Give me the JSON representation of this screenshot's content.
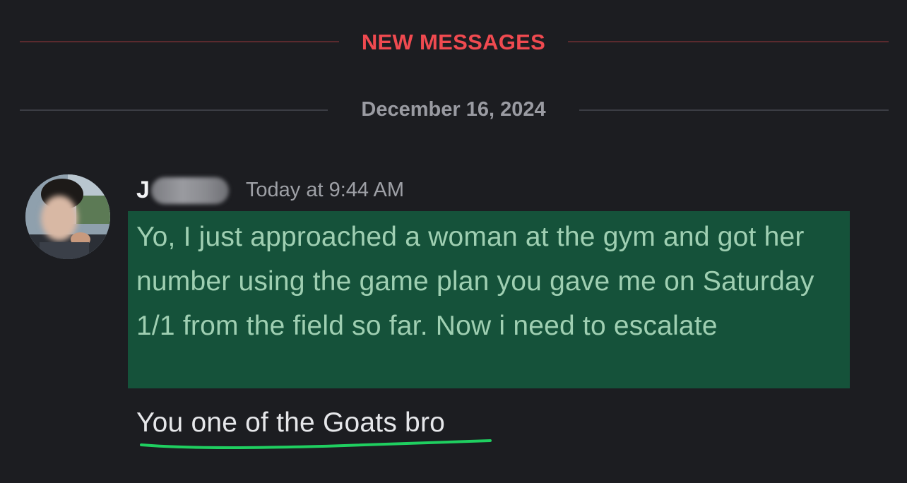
{
  "divider_new": {
    "label": "NEW MESSAGES"
  },
  "divider_date": {
    "label": "December 16, 2024"
  },
  "message": {
    "author_initial": "J",
    "timestamp": "Today at 9:44 AM",
    "text_highlighted": "Yo, I just approached a woman at the gym and got her number using the game plan you gave me on Saturday 1/1 from the field so far. Now i need to escalate",
    "text_reply": "You one of the Goats bro"
  },
  "colors": {
    "background": "#1c1d21",
    "new_messages_red": "#f04a50",
    "highlight_green": "#15523a",
    "underline_green": "#1fcf60"
  }
}
